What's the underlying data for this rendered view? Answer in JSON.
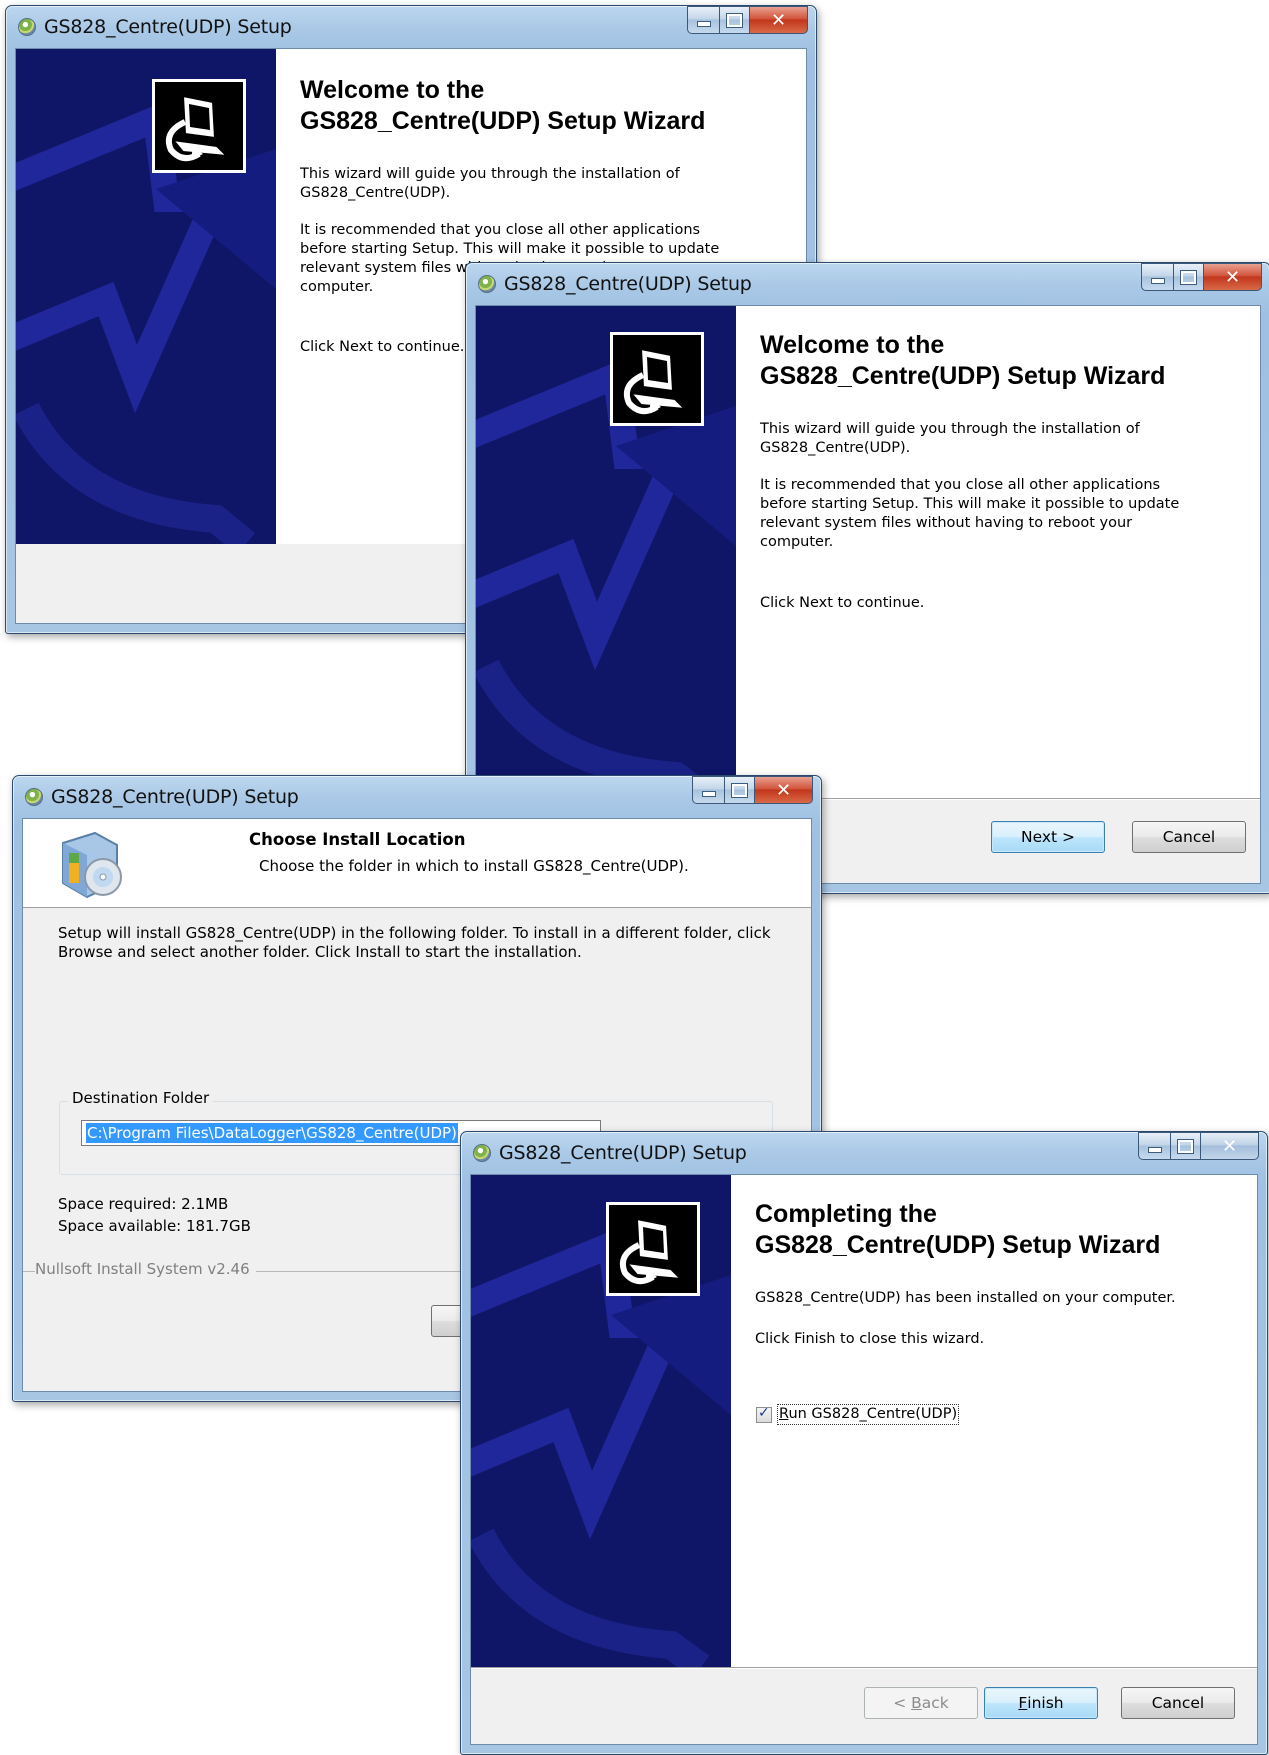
{
  "colors": {
    "sidebar_blue": "#0f1668",
    "default_button_border": "#3c7fb1",
    "selection": "#3399ff"
  },
  "windows": {
    "welcome_a": {
      "title": "GS828_Centre(UDP) Setup",
      "heading_line1": "Welcome to the",
      "heading_line2": "GS828_Centre(UDP) Setup Wizard",
      "para1": "This wizard will guide you through the installation of GS828_Centre(UDP).",
      "para2": "It is recommended that you close all other applications before starting Setup. This will make it possible to update relevant system files without having to reboot your computer.",
      "para3": "Click Next to continue."
    },
    "welcome_b": {
      "title": "GS828_Centre(UDP) Setup",
      "heading_line1": "Welcome to the",
      "heading_line2": "GS828_Centre(UDP) Setup Wizard",
      "para1": "This wizard will guide you through the installation of GS828_Centre(UDP).",
      "para2": "It is recommended that you close all other applications before starting Setup. This will make it possible to update relevant system files without having to reboot your computer.",
      "para3": "Click Next to continue.",
      "next_label": "Next >",
      "cancel_label": "Cancel"
    },
    "location": {
      "title": "GS828_Centre(UDP) Setup",
      "header_title": "Choose Install Location",
      "header_subtitle": "Choose the folder in which to install GS828_Centre(UDP).",
      "body_text": "Setup will install GS828_Centre(UDP) in the following folder. To install in a different folder, click Browse and select another folder. Click Install to start the installation.",
      "group_label": "Destination Folder",
      "path_value": "C:\\Program Files\\DataLogger\\GS828_Centre(UDP)",
      "space_required": "Space required: 2.1MB",
      "space_available": "Space available: 181.7GB",
      "branding": "Nullsoft Install System v2.46",
      "back_partial": "<"
    },
    "finish": {
      "title": "GS828_Centre(UDP) Setup",
      "heading_line1": "Completing the",
      "heading_line2": "GS828_Centre(UDP) Setup Wizard",
      "para1": "GS828_Centre(UDP) has been installed on your computer.",
      "para2": "Click Finish to close this wizard.",
      "run_label_underlined": "R",
      "run_label_rest": "un GS828_Centre(UDP)",
      "run_checked": true,
      "back_underlined": "B",
      "back_prefix": "< ",
      "back_rest": "ack",
      "finish_underlined": "F",
      "finish_rest": "inish",
      "cancel_label": "Cancel"
    }
  }
}
